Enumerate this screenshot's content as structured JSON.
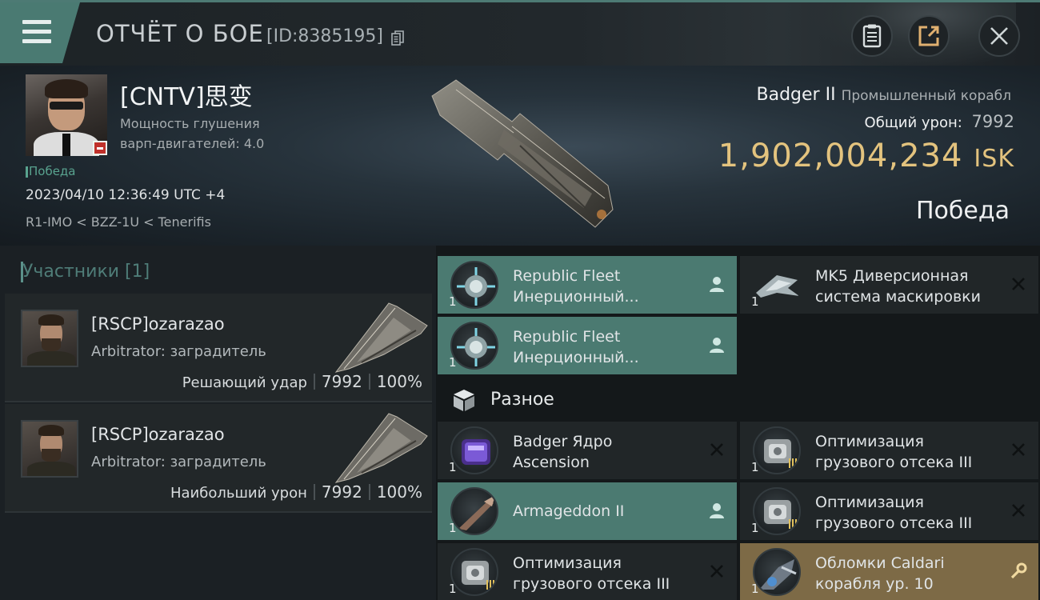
{
  "header": {
    "title": "ОТЧЁТ О БОЕ",
    "id": "[ID:8385195]",
    "icons": [
      "menu-icon",
      "copy-icon",
      "clipboard-icon",
      "share-icon",
      "close-icon"
    ]
  },
  "victim": {
    "name": "[CNTV]思变",
    "stat_line1": "Мощность глушения",
    "stat_line2": "варп-двигателей: 4.0",
    "result_small": "Победа",
    "datetime": "2023/04/10 12:36:49 UTC +4",
    "location": "R1-IMO < BZZ-1U < Tenerifis"
  },
  "ship": {
    "name": "Badger II",
    "class": "Промышленный корабл",
    "damage_label": "Общий урон:",
    "damage_value": "7992",
    "isk_value": "1,902,004,234",
    "isk_currency": "ISK",
    "result": "Победа"
  },
  "participants": {
    "title": "Участники [1]",
    "rows": [
      {
        "name": "[RSCP]ozarazao",
        "ship": "Arbitrator: заградитель",
        "label": "Решающий удар",
        "damage": "7992",
        "percent": "100%"
      },
      {
        "name": "[RSCP]ozarazao",
        "ship": "Arbitrator: заградитель",
        "label": "Наибольший урон",
        "damage": "7992",
        "percent": "100%"
      }
    ]
  },
  "items": {
    "top": [
      {
        "line1": "Republic Fleet",
        "line2": "Инерционный...",
        "qty": "1",
        "icon": "inertial-stabilizer-icon",
        "tag": "person-icon"
      },
      {
        "line1": "MK5 Диверсионная",
        "line2": "система маскировки",
        "qty": "1",
        "icon": "cloaking-device-icon",
        "tag": "close-icon"
      },
      {
        "line1": "Republic Fleet",
        "line2": "Инерционный...",
        "qty": "1",
        "icon": "inertial-stabilizer-icon",
        "tag": "person-icon"
      }
    ],
    "misc_title": "Разное",
    "misc": [
      {
        "line1": "Badger Ядро",
        "line2": "Ascension",
        "qty": "1",
        "icon": "core-crate-icon",
        "tag": "close-icon"
      },
      {
        "line1": "Оптимизация",
        "line2": "грузового отсека III",
        "qty": "1",
        "icon": "cargo-rig-icon",
        "tag": "close-icon"
      },
      {
        "line1": "Armageddon II",
        "line2": "",
        "qty": "1",
        "icon": "ship-blueprint-icon",
        "tag": "person-icon"
      },
      {
        "line1": "Оптимизация",
        "line2": "грузового отсека III",
        "qty": "1",
        "icon": "cargo-rig-icon",
        "tag": "close-icon"
      },
      {
        "line1": "Оптимизация",
        "line2": "грузового отсека III",
        "qty": "1",
        "icon": "cargo-rig-icon",
        "tag": "close-icon"
      },
      {
        "line1": "Обломки Caldari",
        "line2": "корабля ур. 10",
        "qty": "1",
        "icon": "salvage-icon",
        "tag": "wrench-icon"
      }
    ]
  },
  "colors": {
    "teal_row": "#4b7a71",
    "gold_row": "#7d6a46",
    "isk_gold": "#e3c37e",
    "victory_green": "#59a38f"
  }
}
